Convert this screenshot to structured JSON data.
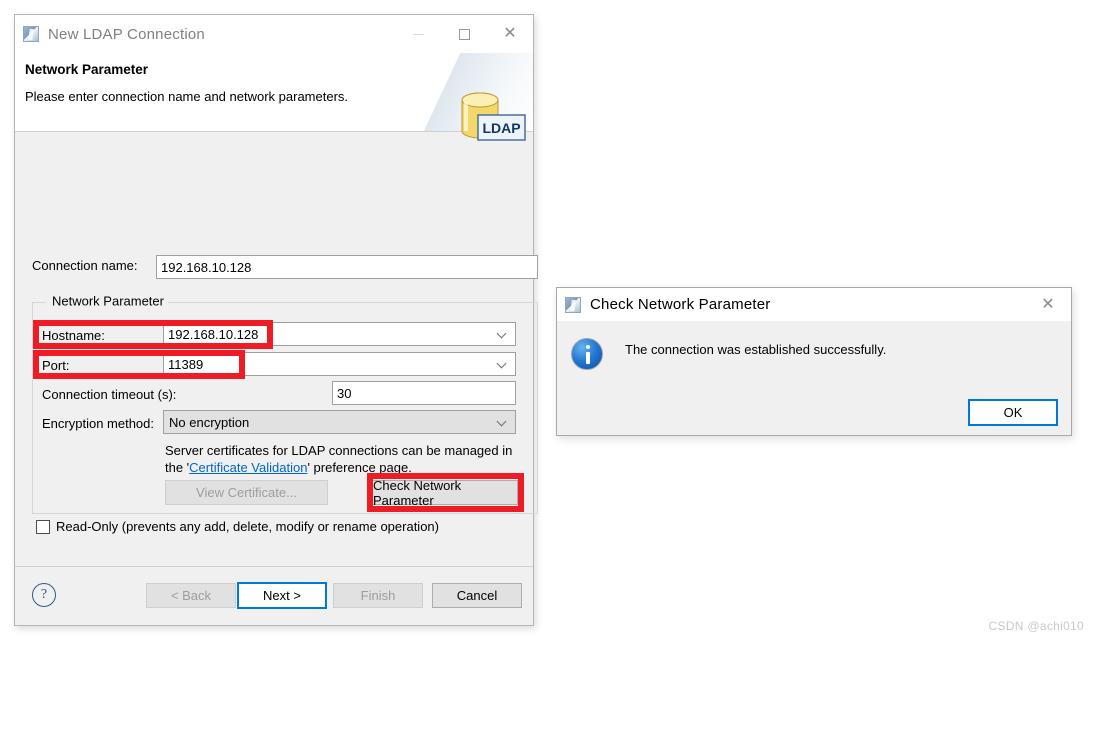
{
  "wizard": {
    "title": "New LDAP Connection",
    "icon": "ldap-app-icon",
    "window_buttons": {
      "minimize": "—",
      "maximize": "□",
      "close": "✕"
    },
    "header": {
      "title": "Network Parameter",
      "subtitle": "Please enter connection name and network parameters.",
      "graphic_label": "LDAP"
    },
    "connection_name": {
      "label": "Connection name:",
      "value": "192.168.10.128"
    },
    "group": {
      "legend": "Network Parameter",
      "hostname": {
        "label": "Hostname:",
        "value": "192.168.10.128"
      },
      "port": {
        "label": "Port:",
        "value": "11389"
      },
      "timeout": {
        "label": "Connection timeout (s):",
        "value": "30"
      },
      "encryption": {
        "label": "Encryption method:",
        "value": "No encryption"
      },
      "cert_note_line1": "Server certificates for LDAP connections can be managed in",
      "cert_note_line2_prefix": "the '",
      "cert_note_link": "Certificate Validation",
      "cert_note_line2_suffix": "' preference page.",
      "view_certificate_button": "View Certificate...",
      "check_network_button": "Check Network Parameter"
    },
    "read_only": {
      "label": "Read-Only (prevents any add, delete, modify or rename operation)",
      "checked": false
    },
    "footer": {
      "help": "?",
      "back": "< Back",
      "next": "Next >",
      "finish": "Finish",
      "cancel": "Cancel"
    }
  },
  "dialog": {
    "title": "Check Network Parameter",
    "close": "✕",
    "icon": "information-icon",
    "message": "The connection was established successfully.",
    "ok_button": "OK"
  },
  "watermark": "CSDN @achi010",
  "colors": {
    "annotation_red": "#ee1c25",
    "focus_blue": "#0078d7",
    "link_blue": "#0066cc"
  }
}
